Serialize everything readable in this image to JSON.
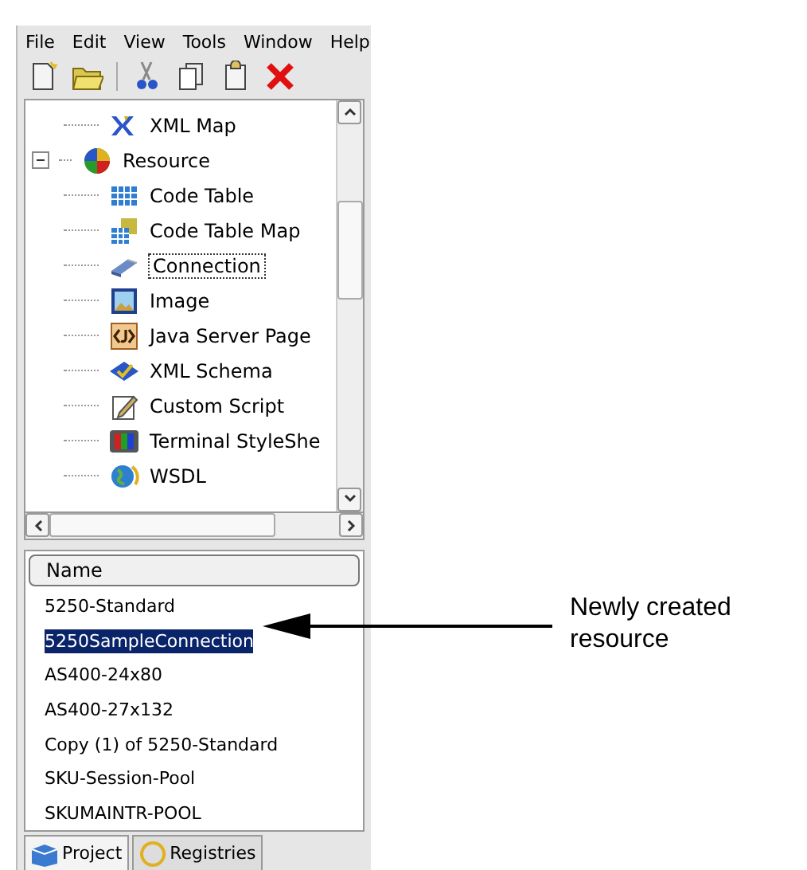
{
  "menu_bar": [
    "File",
    "Edit",
    "View",
    "Tools",
    "Window",
    "Help"
  ],
  "toolbar": [
    {
      "kind": "new"
    },
    {
      "kind": "open"
    },
    {
      "kind": "separator"
    },
    {
      "kind": "cut"
    },
    {
      "kind": "copy"
    },
    {
      "kind": "paste"
    },
    {
      "kind": "delete"
    }
  ],
  "tree": [
    {
      "label": "XML Map",
      "kind": "xml-map"
    },
    {
      "label": "Resource",
      "kind": "resource",
      "expanded": true,
      "children": [
        {
          "label": "Code Table",
          "kind": "code-table",
          "focused": false
        },
        {
          "label": "Code Table Map",
          "kind": "code-table-map",
          "focused": false
        },
        {
          "label": "Connection",
          "kind": "connection",
          "focused": true
        },
        {
          "label": "Image",
          "kind": "image",
          "focused": false
        },
        {
          "label": "Java Server Page",
          "kind": "jsp",
          "focused": false
        },
        {
          "label": "XML Schema",
          "kind": "xml-schema",
          "focused": false
        },
        {
          "label": "Custom Script",
          "kind": "custom-script",
          "focused": false
        },
        {
          "label": "Terminal StyleShe",
          "kind": "terminal",
          "focused": false
        },
        {
          "label": "WSDL",
          "kind": "wsdl",
          "focused": false
        }
      ]
    }
  ],
  "list": {
    "column": "Name",
    "rows": [
      {
        "name": "5250-Standard",
        "selected": false
      },
      {
        "name": "5250SampleConnection",
        "selected": true
      },
      {
        "name": "AS400-24x80",
        "selected": false
      },
      {
        "name": "AS400-27x132",
        "selected": false
      },
      {
        "name": "Copy (1) of 5250-Standard",
        "selected": false
      },
      {
        "name": "SKU-Session-Pool",
        "selected": false
      },
      {
        "name": "SKUMAINTR-POOL",
        "selected": false
      }
    ]
  },
  "tabs": [
    {
      "label": "Project",
      "kind": "project",
      "selected": true
    },
    {
      "label": "Registries",
      "kind": "registries",
      "selected": false
    }
  ],
  "callout": "Newly created resource"
}
